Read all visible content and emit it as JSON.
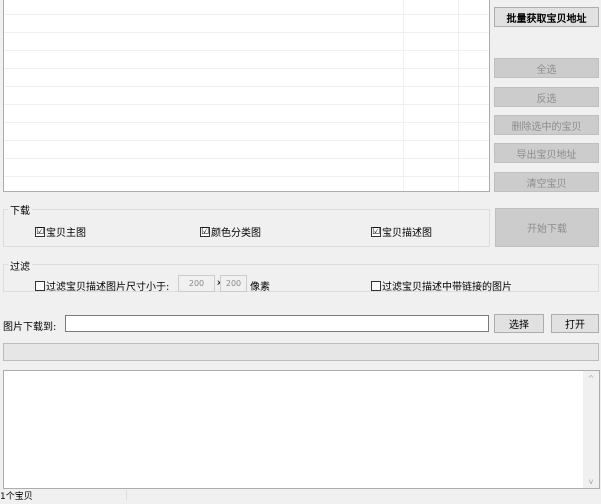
{
  "buttons": {
    "batch_fetch": "批量获取宝贝地址",
    "select_all": "全选",
    "invert": "反选",
    "delete_selected": "删除选中的宝贝",
    "export": "导出宝贝地址",
    "clear": "清空宝贝",
    "start_download": "开始下载",
    "choose": "选择",
    "open": "打开"
  },
  "download_group": {
    "title": "下载",
    "options": [
      {
        "label": "宝贝主图",
        "checked": true
      },
      {
        "label": "颜色分类图",
        "checked": true
      },
      {
        "label": "宝贝描述图",
        "checked": true
      }
    ]
  },
  "filter_group": {
    "title": "过滤",
    "size_filter": {
      "label": "过滤宝贝描述图片尺寸小于:",
      "checked": false,
      "width": "200",
      "x": "x",
      "height": "200",
      "unit": "像素"
    },
    "link_filter": {
      "label": "过滤宝贝描述中带链接的图片",
      "checked": false
    }
  },
  "path": {
    "label": "图片下载到:",
    "value": ""
  },
  "progress": 0,
  "status": {
    "count": "1个宝贝"
  },
  "icons": {
    "checked": "☑",
    "up": "^",
    "down": "v"
  }
}
